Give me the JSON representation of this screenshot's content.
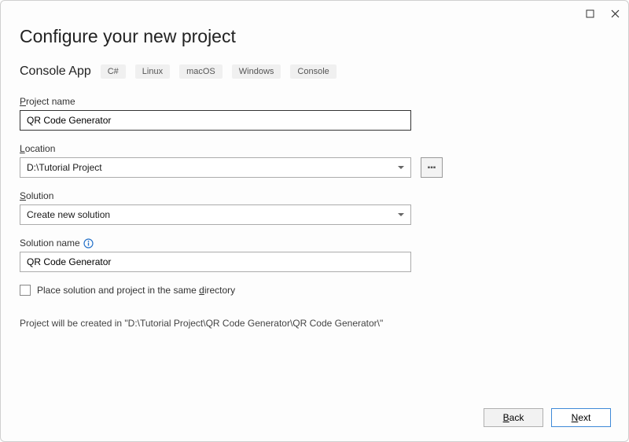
{
  "page": {
    "title": "Configure your new project"
  },
  "template": {
    "name": "Console App",
    "tags": [
      "C#",
      "Linux",
      "macOS",
      "Windows",
      "Console"
    ]
  },
  "fields": {
    "projectName": {
      "label_pre": "",
      "label_u": "P",
      "label_post": "roject name",
      "value": "QR Code Generator"
    },
    "location": {
      "label_u": "L",
      "label_post": "ocation",
      "value": "D:\\Tutorial Project"
    },
    "solution": {
      "label_u": "S",
      "label_post": "olution",
      "value": "Create new solution"
    },
    "solutionName": {
      "label": "Solution name",
      "value": "QR Code Generator"
    }
  },
  "checkbox": {
    "label_pre": "Place solution and project in the same ",
    "label_u": "d",
    "label_post": "irectory"
  },
  "info": {
    "text": "Project will be created in \"D:\\Tutorial Project\\QR Code Generator\\QR Code Generator\\\""
  },
  "footer": {
    "back_u": "B",
    "back_post": "ack",
    "next_u": "N",
    "next_post": "ext"
  }
}
